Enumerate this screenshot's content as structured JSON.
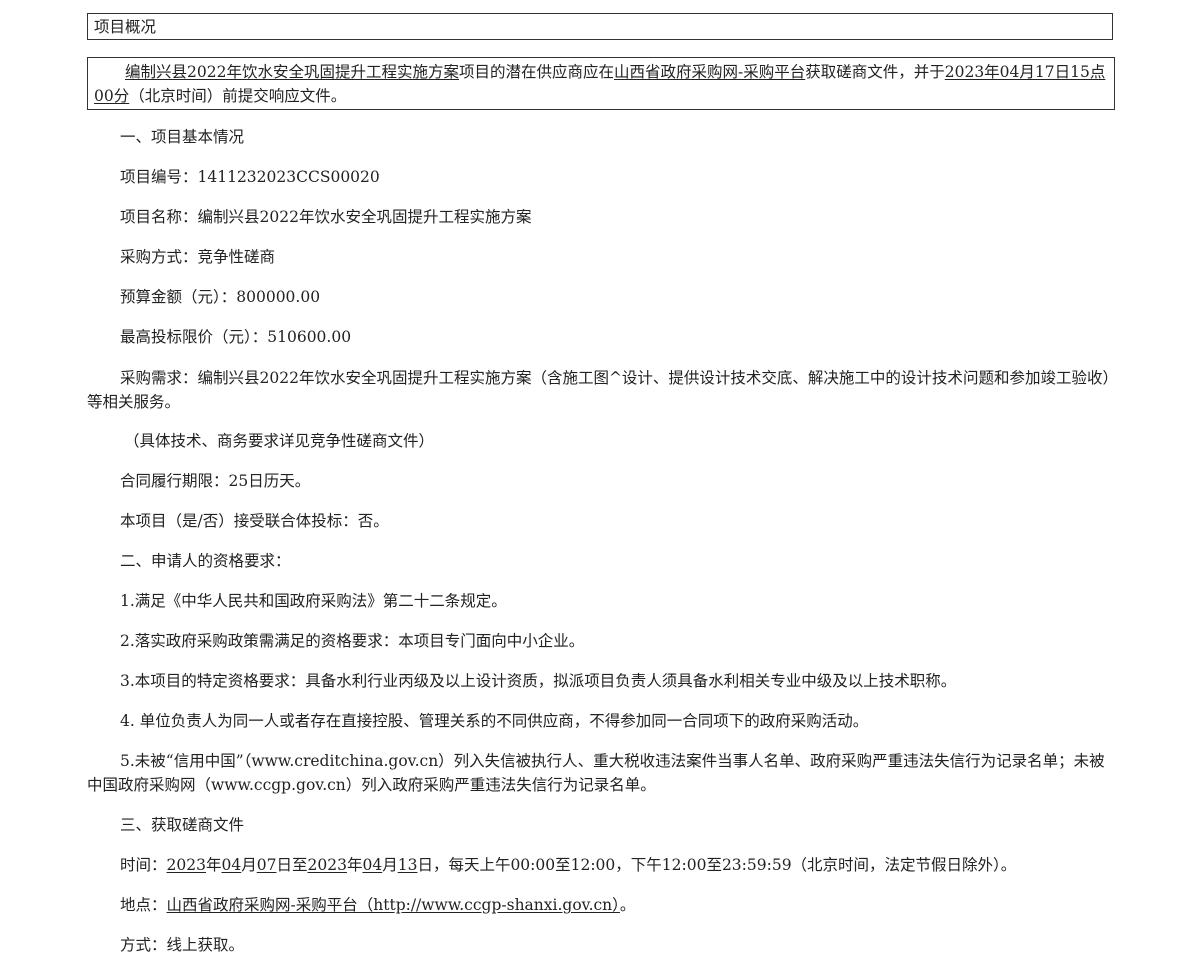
{
  "box_title": "项目概况",
  "summary": {
    "project_name_link": "编制兴县2022年饮水安全巩固提升工程实施方案",
    "text_1": "项目的潜在供应商应在",
    "platform_link": "山西省政府采购网-采购平台",
    "text_2": "获取磋商文件，并于",
    "deadline_part1": "2023年04月17日15点",
    "deadline_part2": "00分",
    "text_3": "（北京时间）前提交响应文件。"
  },
  "section1": {
    "heading": "一、项目基本情况",
    "project_no": "项目编号：1411232023CCS00020",
    "project_name": "项目名称：编制兴县2022年饮水安全巩固提升工程实施方案",
    "method": "采购方式：竞争性磋商",
    "budget": "预算金额（元）：800000.00",
    "max_price": "最高投标限价（元）：510600.00",
    "requirement": "采购需求：编制兴县2022年饮水安全巩固提升工程实施方案（含施工图^设计、提供设计技术交底、解决施工中的设计技术问题和参加竣工验收）等相关服务。",
    "details_note": "（具体技术、商务要求详见竞争性磋商文件）",
    "contract_period": "合同履行期限：25日历天。",
    "consortium": "本项目（是/否）接受联合体投标：否。"
  },
  "section2": {
    "heading": "二、申请人的资格要求：",
    "item1": "1.满足《中华人民共和国政府采购法》第二十二条规定。",
    "item2": "2.落实政府采购政策需满足的资格要求：本项目专门面向中小企业。",
    "item3": "3.本项目的特定资格要求：具备水利行业丙级及以上设计资质，拟派项目负责人须具备水利相关专业中级及以上技术职称。",
    "item4": "4. 单位负责人为同一人或者存在直接控股、管理关系的不同供应商，不得参加同一合同项下的政府采购活动。",
    "item5": "5.未被“信用中国”（www.creditchina.gov.cn）列入失信被执行人、重大税收违法案件当事人名单、政府采购严重违法失信行为记录名单；未被中国政府采购网（www.ccgp.gov.cn）列入政府采购严重违法失信行为记录名单。"
  },
  "section3": {
    "heading": "三、获取磋商文件",
    "time_label": "时间：",
    "time_start_year": "2023",
    "time_start_mid1": "年",
    "time_start_month": "04",
    "time_start_mid2": "月",
    "time_start_day": "07",
    "time_start_mid3": "日至",
    "time_end_year": "2023",
    "time_end_mid1": "年",
    "time_end_month": "04",
    "time_end_mid2": "月",
    "time_end_day": "13",
    "time_rest": "日，每天上午00:00至12:00，下午12:00至23:59:59（北京时间，法定节假日除外）。",
    "place_label": "地点：",
    "place_link": "山西省政府采购网-采购平台（http://www.ccgp-shanxi.gov.cn）",
    "place_end": "。",
    "method": "方式：线上获取。"
  }
}
